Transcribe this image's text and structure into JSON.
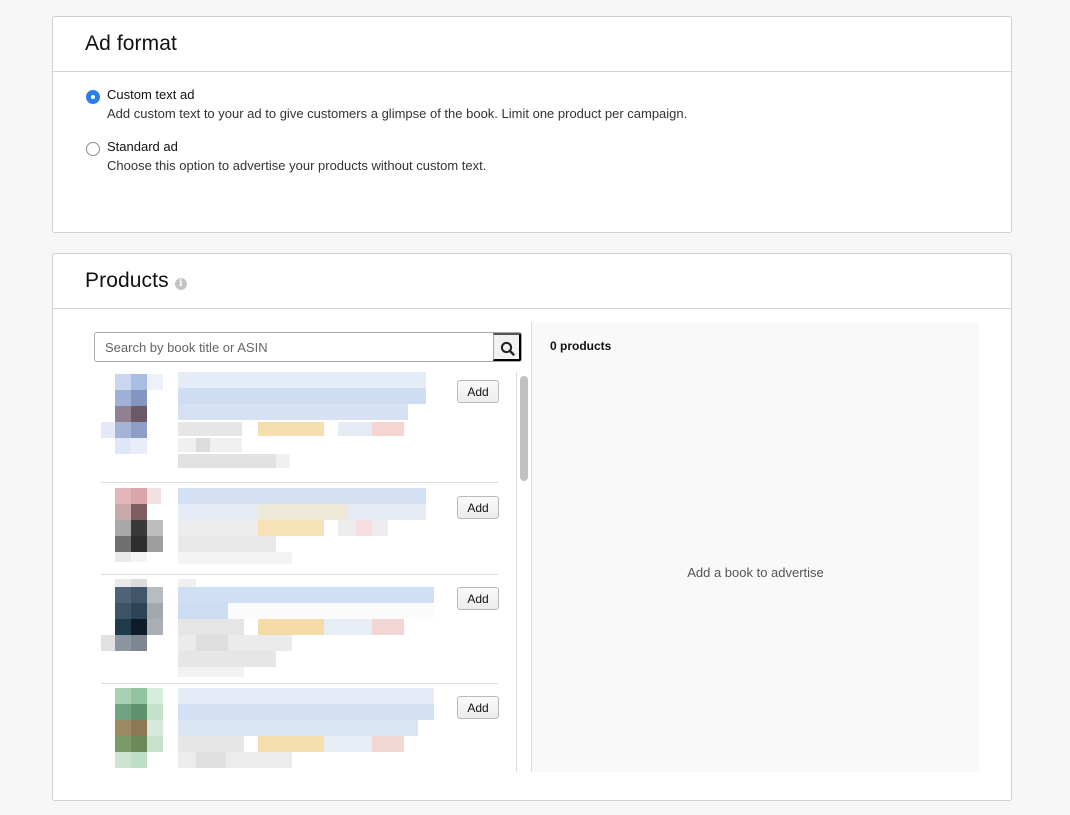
{
  "ad_format": {
    "title": "Ad format",
    "options": [
      {
        "label": "Custom text ad",
        "description": "Add custom text to your ad to give customers a glimpse of the book. Limit one product per campaign.",
        "checked": true
      },
      {
        "label": "Standard ad",
        "description": "Choose this option to advertise your products without custom text.",
        "checked": false
      }
    ]
  },
  "products": {
    "title": "Products",
    "search": {
      "placeholder": "Search by book title or ASIN"
    },
    "items": [
      {
        "add_label": "Add"
      },
      {
        "add_label": "Add"
      },
      {
        "add_label": "Add"
      },
      {
        "add_label": "Add"
      }
    ],
    "selected": {
      "count_text": "0 products",
      "empty_text": "Add a book to advertise"
    }
  },
  "colors": {
    "accent": "#2b7de9"
  }
}
